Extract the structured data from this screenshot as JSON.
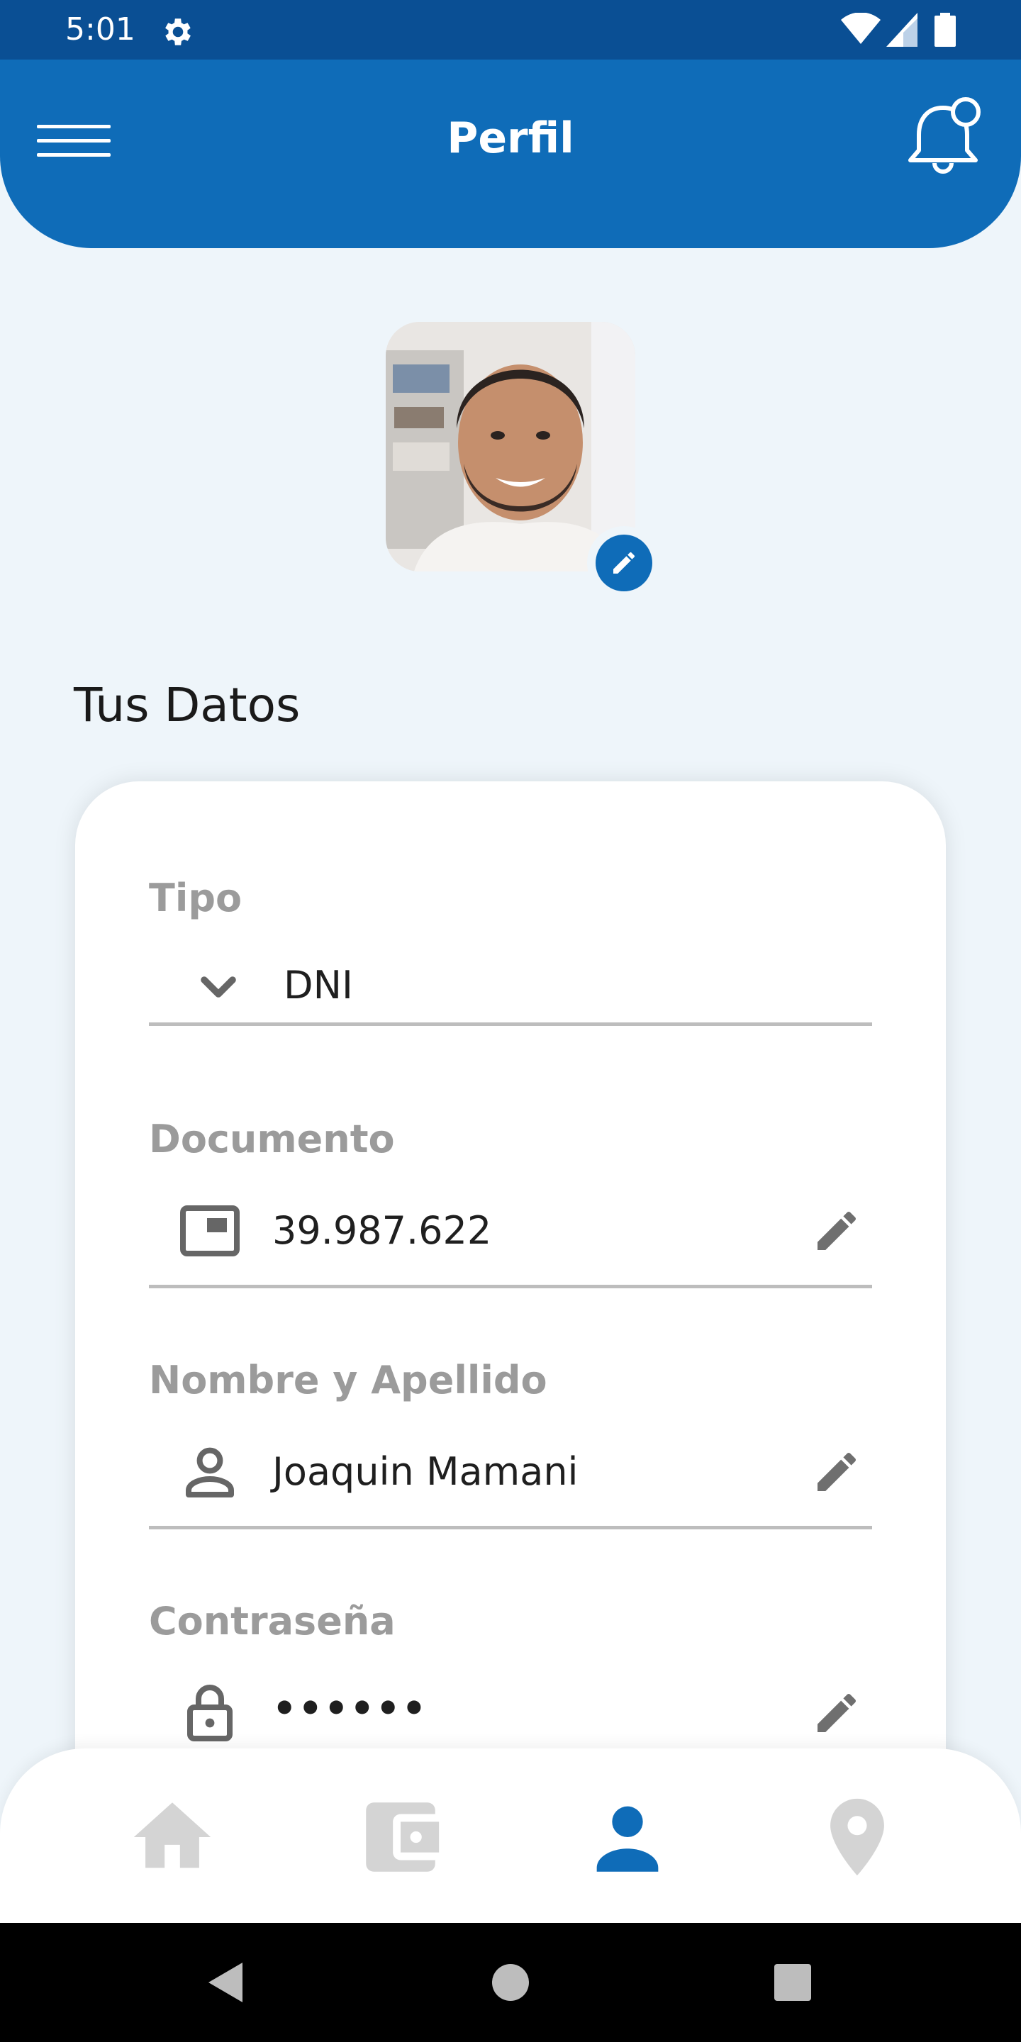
{
  "status_bar": {
    "time": "5:01",
    "icons": [
      "gear-icon",
      "wifi-icon",
      "signal-icon",
      "battery-icon"
    ]
  },
  "app_bar": {
    "title": "Perfil",
    "menu_icon": "hamburger-menu-icon",
    "notification_icon": "bell-icon"
  },
  "profile": {
    "avatar_icon": "profile-photo",
    "edit_icon": "pencil-icon"
  },
  "section": {
    "title": "Tus Datos"
  },
  "form": {
    "tipo": {
      "label": "Tipo",
      "value": "DNI",
      "icon": "chevron-down-icon"
    },
    "documento": {
      "label": "Documento",
      "value": "39.987.622",
      "icon": "id-card-icon",
      "edit_icon": "pencil-icon"
    },
    "nombre": {
      "label": "Nombre y Apellido",
      "value": "Joaquin Mamani",
      "icon": "person-icon",
      "edit_icon": "pencil-icon"
    },
    "contrasena": {
      "label": "Contraseña",
      "value": "••••••",
      "icon": "lock-icon",
      "edit_icon": "pencil-icon"
    }
  },
  "bottom_nav": {
    "items": [
      {
        "name": "home",
        "icon": "home-icon",
        "active": false
      },
      {
        "name": "wallet",
        "icon": "wallet-icon",
        "active": false
      },
      {
        "name": "profile",
        "icon": "person-icon",
        "active": true
      },
      {
        "name": "location",
        "icon": "location-pin-icon",
        "active": false
      }
    ]
  },
  "colors": {
    "primary": "#0f6cb8",
    "status_bar": "#0a4f94",
    "background": "#eef5fa",
    "label_gray": "#9b9b9b",
    "inactive_icon": "#d0d0d0"
  }
}
